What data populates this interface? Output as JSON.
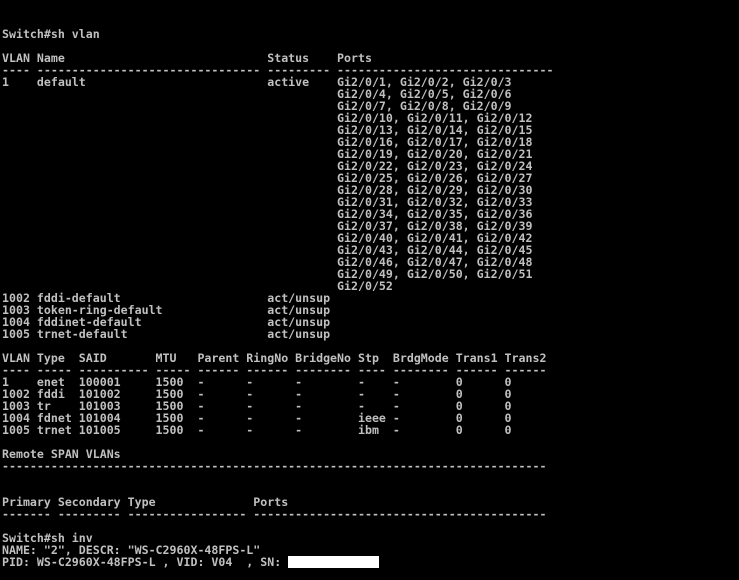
{
  "terminal": {
    "foreground": "#c0c0c0",
    "background": "#000000",
    "lines": [
      "Switch#sh vlan",
      "",
      "VLAN Name                             Status    Ports",
      "---- -------------------------------- --------- -------------------------------",
      "1    default                          active    Gi2/0/1, Gi2/0/2, Gi2/0/3",
      "                                                Gi2/0/4, Gi2/0/5, Gi2/0/6",
      "                                                Gi2/0/7, Gi2/0/8, Gi2/0/9",
      "                                                Gi2/0/10, Gi2/0/11, Gi2/0/12",
      "                                                Gi2/0/13, Gi2/0/14, Gi2/0/15",
      "                                                Gi2/0/16, Gi2/0/17, Gi2/0/18",
      "                                                Gi2/0/19, Gi2/0/20, Gi2/0/21",
      "                                                Gi2/0/22, Gi2/0/23, Gi2/0/24",
      "                                                Gi2/0/25, Gi2/0/26, Gi2/0/27",
      "                                                Gi2/0/28, Gi2/0/29, Gi2/0/30",
      "                                                Gi2/0/31, Gi2/0/32, Gi2/0/33",
      "                                                Gi2/0/34, Gi2/0/35, Gi2/0/36",
      "                                                Gi2/0/37, Gi2/0/38, Gi2/0/39",
      "                                                Gi2/0/40, Gi2/0/41, Gi2/0/42",
      "                                                Gi2/0/43, Gi2/0/44, Gi2/0/45",
      "                                                Gi2/0/46, Gi2/0/47, Gi2/0/48",
      "                                                Gi2/0/49, Gi2/0/50, Gi2/0/51",
      "                                                Gi2/0/52",
      "1002 fddi-default                     act/unsup",
      "1003 token-ring-default               act/unsup",
      "1004 fddinet-default                  act/unsup",
      "1005 trnet-default                    act/unsup",
      "",
      "VLAN Type  SAID       MTU   Parent RingNo BridgeNo Stp  BrdgMode Trans1 Trans2",
      "---- ----- ---------- ----- ------ ------ -------- ---- -------- ------ ------",
      "1    enet  100001     1500  -      -      -        -    -        0      0",
      "1002 fddi  101002     1500  -      -      -        -    -        0      0",
      "1003 tr    101003     1500  -      -      -        -    -        0      0",
      "1004 fdnet 101004     1500  -      -      -        ieee -        0      0",
      "1005 trnet 101005     1500  -      -      -        ibm  -        0      0",
      "",
      "Remote SPAN VLANs",
      "------------------------------------------------------------------------------",
      "",
      "",
      "Primary Secondary Type              Ports",
      "------- --------- ----------------- ------------------------------------------",
      "",
      "Switch#sh inv",
      "NAME: \"2\", DESCR: \"WS-C2960X-48FPS-L\"",
      "PID: WS-C2960X-48FPS-L , VID: V04  , SN: "
    ]
  }
}
